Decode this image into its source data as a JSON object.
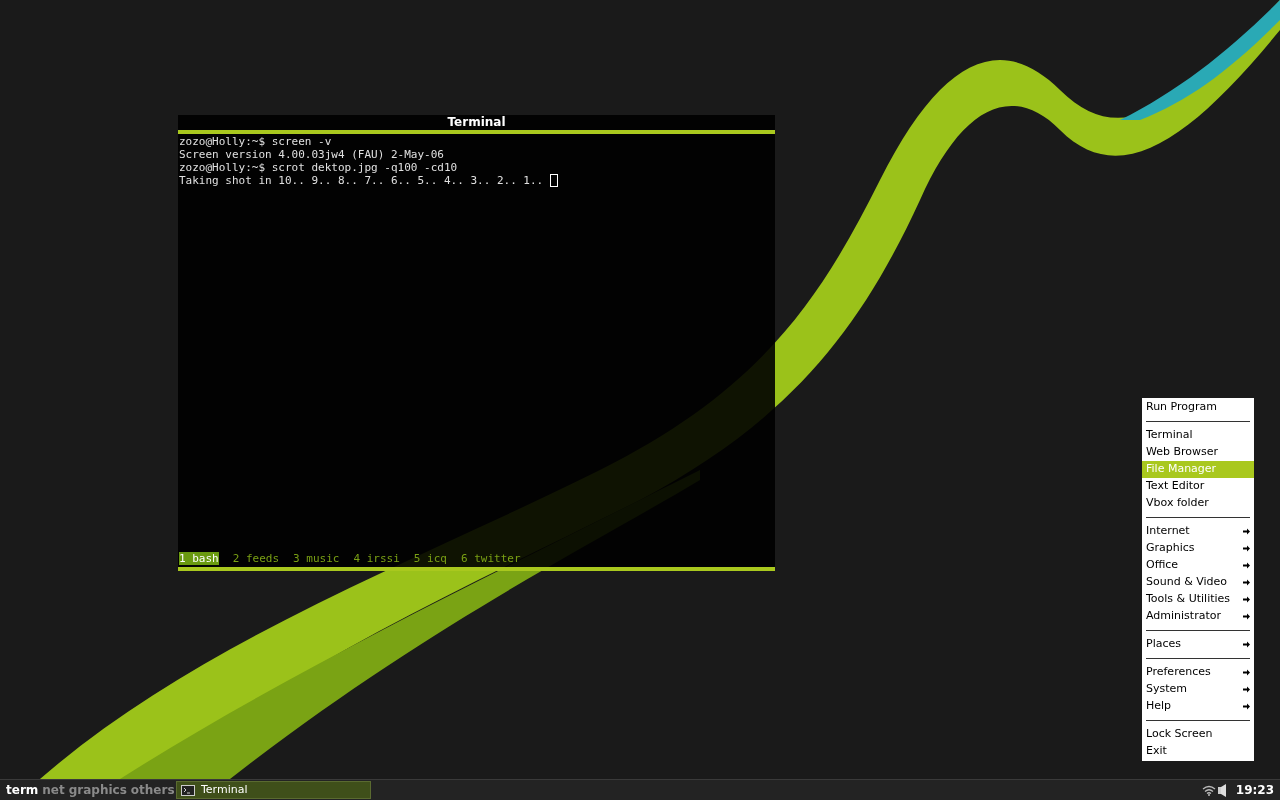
{
  "terminal": {
    "title": "Terminal",
    "lines": [
      "zozo@Holly:~$ screen -v",
      "Screen version 4.00.03jw4 (FAU) 2-May-06",
      "zozo@Holly:~$ scrot dektop.jpg -q100 -cd10",
      "Taking shot in 10.. 9.. 8.. 7.. 6.. 5.. 4.. 3.. 2.. 1.. "
    ],
    "screen_windows": [
      {
        "label": "1 bash",
        "selected": true
      },
      {
        "label": "2 feeds",
        "selected": false
      },
      {
        "label": "3 music",
        "selected": false
      },
      {
        "label": "4 irssi",
        "selected": false
      },
      {
        "label": "5 icq",
        "selected": false
      },
      {
        "label": "6 twitter",
        "selected": false
      }
    ]
  },
  "menu": [
    {
      "kind": "item",
      "label": "Run Program",
      "submenu": false,
      "selected": false
    },
    {
      "kind": "separator"
    },
    {
      "kind": "item",
      "label": "Terminal",
      "submenu": false,
      "selected": false
    },
    {
      "kind": "item",
      "label": "Web Browser",
      "submenu": false,
      "selected": false
    },
    {
      "kind": "item",
      "label": "File Manager",
      "submenu": false,
      "selected": true
    },
    {
      "kind": "item",
      "label": "Text Editor",
      "submenu": false,
      "selected": false
    },
    {
      "kind": "item",
      "label": "Vbox folder",
      "submenu": false,
      "selected": false
    },
    {
      "kind": "separator"
    },
    {
      "kind": "item",
      "label": "Internet",
      "submenu": true,
      "selected": false
    },
    {
      "kind": "item",
      "label": "Graphics",
      "submenu": true,
      "selected": false
    },
    {
      "kind": "item",
      "label": "Office",
      "submenu": true,
      "selected": false
    },
    {
      "kind": "item",
      "label": "Sound & Video",
      "submenu": true,
      "selected": false
    },
    {
      "kind": "item",
      "label": "Tools & Utilities",
      "submenu": true,
      "selected": false
    },
    {
      "kind": "item",
      "label": "Administrator",
      "submenu": true,
      "selected": false
    },
    {
      "kind": "separator"
    },
    {
      "kind": "item",
      "label": "Places",
      "submenu": true,
      "selected": false
    },
    {
      "kind": "separator"
    },
    {
      "kind": "item",
      "label": "Preferences",
      "submenu": true,
      "selected": false
    },
    {
      "kind": "item",
      "label": "System",
      "submenu": true,
      "selected": false
    },
    {
      "kind": "item",
      "label": "Help",
      "submenu": true,
      "selected": false
    },
    {
      "kind": "separator"
    },
    {
      "kind": "item",
      "label": "Lock Screen",
      "submenu": false,
      "selected": false
    },
    {
      "kind": "item",
      "label": "Exit",
      "submenu": false,
      "selected": false
    }
  ],
  "taskbar": {
    "desktops": [
      {
        "label": "term",
        "selected": true
      },
      {
        "label": "net",
        "selected": false
      },
      {
        "label": "graphics",
        "selected": false
      },
      {
        "label": "others",
        "selected": false
      }
    ],
    "tasks": [
      {
        "label": "Terminal",
        "selected": true
      }
    ],
    "clock": "19:23"
  }
}
